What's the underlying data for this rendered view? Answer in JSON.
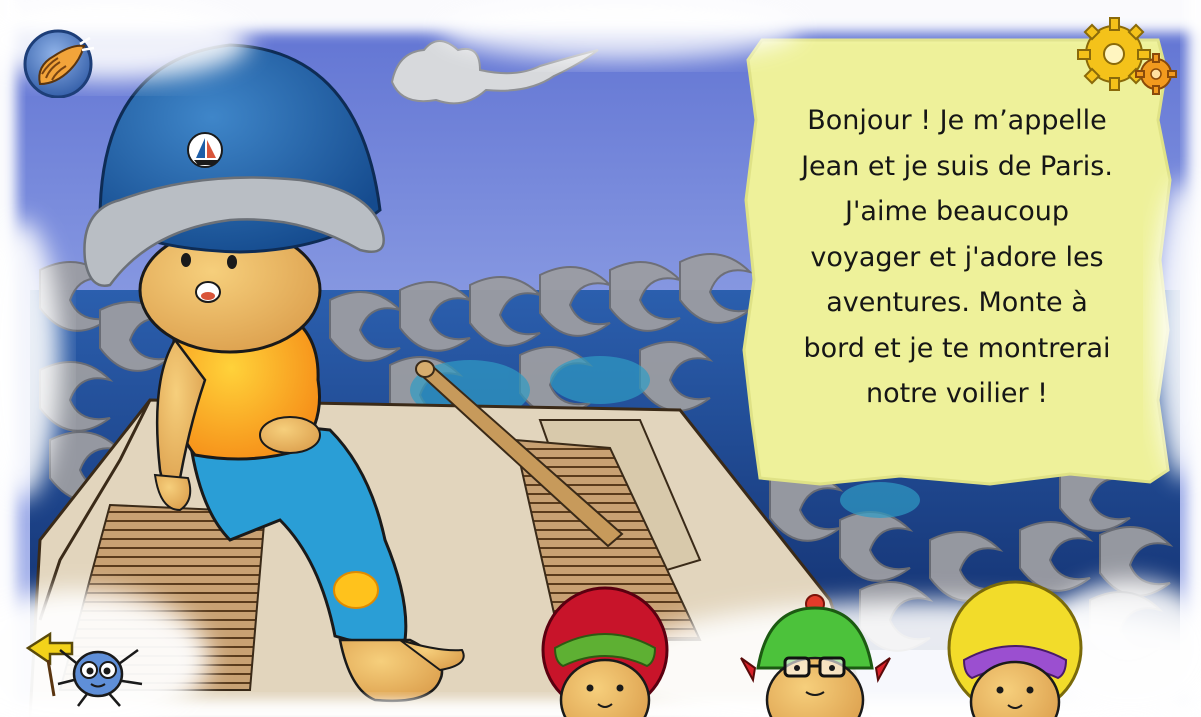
{
  "story": {
    "speech_lines": [
      "Bonjour ! Je m’appelle",
      "Jean et je suis de Paris.",
      "J'aime beaucoup",
      "voyager et j'adore les",
      "aventures. Monte à",
      "bord et je te montrerai",
      "notre voilier !"
    ]
  },
  "icons": {
    "audio": "seashell-icon",
    "settings": "gears-icon",
    "back": "arrow-left-icon",
    "guide": "spider-character-icon"
  },
  "characters": [
    "red-hair-kid",
    "green-hat-kid",
    "yellow-hair-kid"
  ],
  "colors": {
    "sky": "#6f86d8",
    "sea": "#1d3f8f",
    "speech_bubble": "#f1f39a",
    "helmet": "#1e5ea8",
    "shirt": "#f7931e",
    "pants": "#29a0d6"
  }
}
